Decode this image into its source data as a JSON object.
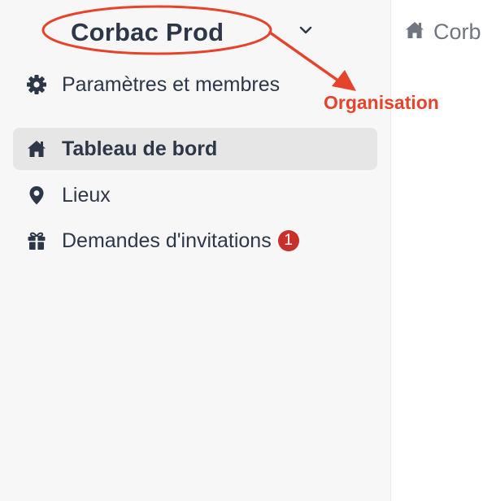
{
  "sidebar": {
    "org_switcher": {
      "name": "Corbac Prod",
      "chevron_icon": "chevron-down-icon"
    },
    "items": [
      {
        "label": "Paramètres et membres",
        "icon": "gear-icon",
        "active": false
      },
      {
        "label": "Tableau de bord",
        "icon": "home-icon",
        "active": true
      },
      {
        "label": "Lieux",
        "icon": "map-pin-icon",
        "active": false
      },
      {
        "label": "Demandes d'invitations",
        "icon": "gift-icon",
        "active": false,
        "badge": "1"
      }
    ]
  },
  "main": {
    "breadcrumb": {
      "icon": "home-icon",
      "text": "Corb"
    }
  },
  "annotation": {
    "label": "Organisation",
    "color": "#e5432a"
  },
  "colors": {
    "sidebar_bg": "#f7f7f8",
    "active_item_bg": "#e6e6e6",
    "text": "#2d3748",
    "badge_bg": "#c9302c"
  }
}
